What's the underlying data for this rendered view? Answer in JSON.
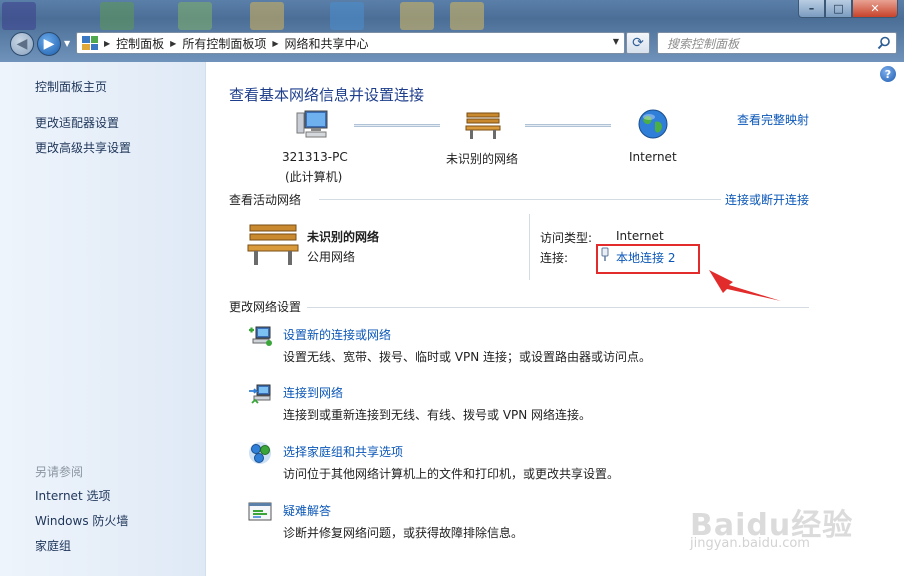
{
  "address_bar": {
    "crumbs": [
      "控制面板",
      "所有控制面板项",
      "网络和共享中心"
    ]
  },
  "search": {
    "placeholder": "搜索控制面板"
  },
  "window_buttons": {
    "minimize": "–",
    "maximize": "□",
    "close": "✕"
  },
  "sidebar": {
    "links": [
      "控制面板主页",
      "更改适配器设置",
      "更改高级共享设置"
    ],
    "see_also_heading": "另请参阅",
    "see_also": [
      "Internet 选项",
      "Windows 防火墙",
      "家庭组"
    ]
  },
  "main": {
    "title": "查看基本网络信息并设置连接",
    "view_full_map": "查看完整映射",
    "map": {
      "computer_name": "321313-PC",
      "computer_sub": "(此计算机)",
      "network_name": "未识别的网络",
      "internet": "Internet"
    },
    "active_networks": {
      "heading": "查看活动网络",
      "connect_disconnect": "连接或断开连接",
      "network_name": "未识别的网络",
      "network_type": "公用网络",
      "access_type_label": "访问类型:",
      "access_type_value": "Internet",
      "connections_label": "连接:",
      "connection_link": "本地连接 2"
    },
    "change_settings": {
      "heading": "更改网络设置",
      "tasks": [
        {
          "title": "设置新的连接或网络",
          "desc": "设置无线、宽带、拨号、临时或 VPN 连接；或设置路由器或访问点。",
          "icon": "new-connection-icon"
        },
        {
          "title": "连接到网络",
          "desc": "连接到或重新连接到无线、有线、拨号或 VPN 网络连接。",
          "icon": "connect-network-icon"
        },
        {
          "title": "选择家庭组和共享选项",
          "desc": "访问位于其他网络计算机上的文件和打印机，或更改共享设置。",
          "icon": "homegroup-icon"
        },
        {
          "title": "疑难解答",
          "desc": "诊断并修复网络问题，或获得故障排除信息。",
          "icon": "troubleshoot-icon"
        }
      ]
    }
  },
  "watermark": {
    "text": "Baidu经验",
    "sub": "jingyan.baidu.com"
  },
  "colors": {
    "link": "#0b57b8",
    "title": "#1e3e8c",
    "highlight": "#e22b2b"
  }
}
